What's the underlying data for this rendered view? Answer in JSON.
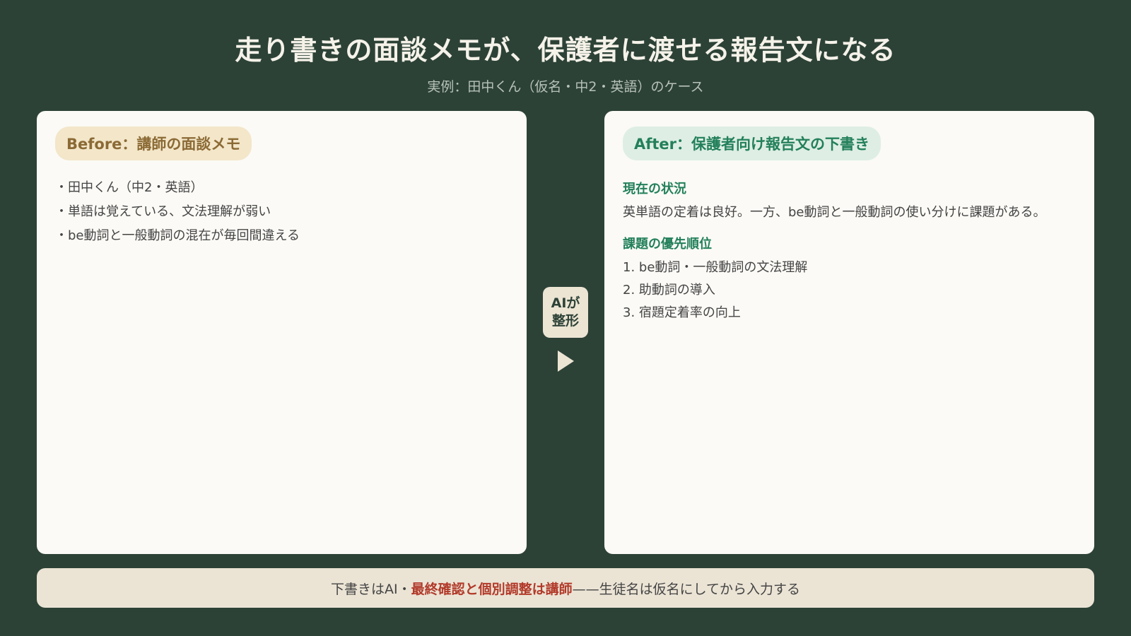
{
  "header": {
    "title": "走り書きの面談メモが、保護者に渡せる報告文になる",
    "subtitle": "実例：田中くん（仮名・中2・英語）のケース"
  },
  "before": {
    "label": "Before：講師の面談メモ",
    "items": [
      "田中くん（中2・英語）",
      "単語は覚えている、文法理解が弱い",
      "be動詞と一般動詞の混在が毎回間違える"
    ]
  },
  "transform": {
    "line1": "AIが",
    "line2": "整形"
  },
  "after": {
    "label": "After：保護者向け報告文の下書き",
    "section1_heading": "現在の状況",
    "section1_text": "英単語の定着は良好。一方、be動詞と一般動詞の使い分けに課題がある。",
    "section2_heading": "課題の優先順位",
    "priorities": [
      "1. be動詞・一般動詞の文法理解",
      "2. 助動詞の導入",
      "3. 宿題定着率の向上"
    ]
  },
  "footer": {
    "part1": "下書きはAI・",
    "emphasis": "最終確認と個別調整は講師",
    "part2": "——生徒名は仮名にしてから入力する"
  },
  "colors": {
    "background": "#2d4237",
    "panel": "#fbfaf6",
    "before_accent": "#8b6a35",
    "after_accent": "#23805a",
    "emphasis": "#b23a2a"
  }
}
